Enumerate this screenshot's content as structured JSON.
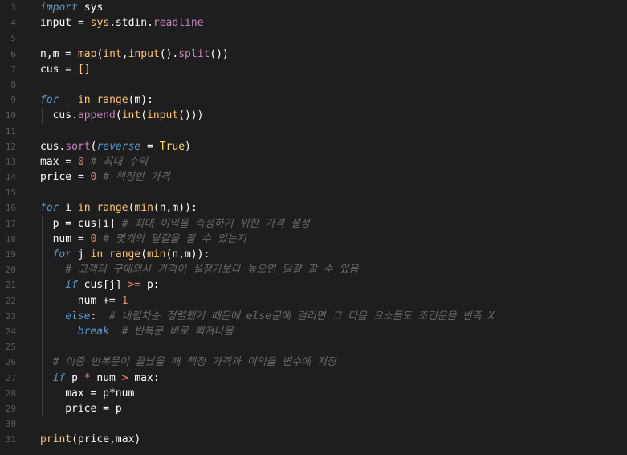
{
  "lines": [
    {
      "num": "3",
      "indent": 0,
      "tokens": [
        {
          "t": "import",
          "c": "kw"
        },
        {
          "t": " sys",
          "c": "plain"
        }
      ]
    },
    {
      "num": "4",
      "indent": 0,
      "tokens": [
        {
          "t": "input",
          "c": "plain"
        },
        {
          "t": " = ",
          "c": "plain"
        },
        {
          "t": "sys",
          "c": "fn"
        },
        {
          "t": ".stdin.",
          "c": "plain"
        },
        {
          "t": "readline",
          "c": "prop"
        }
      ]
    },
    {
      "num": "5",
      "indent": 0,
      "tokens": []
    },
    {
      "num": "6",
      "indent": 0,
      "tokens": [
        {
          "t": "n,m",
          "c": "plain"
        },
        {
          "t": " = ",
          "c": "plain"
        },
        {
          "t": "map",
          "c": "fn"
        },
        {
          "t": "(",
          "c": "plain"
        },
        {
          "t": "int",
          "c": "fn"
        },
        {
          "t": ",",
          "c": "plain"
        },
        {
          "t": "input",
          "c": "fn"
        },
        {
          "t": "().",
          "c": "plain"
        },
        {
          "t": "split",
          "c": "prop"
        },
        {
          "t": "())",
          "c": "plain"
        }
      ]
    },
    {
      "num": "7",
      "indent": 0,
      "tokens": [
        {
          "t": "cus",
          "c": "plain"
        },
        {
          "t": " = ",
          "c": "plain"
        },
        {
          "t": "[]",
          "c": "fn"
        }
      ]
    },
    {
      "num": "8",
      "indent": 0,
      "tokens": []
    },
    {
      "num": "9",
      "indent": 0,
      "tokens": [
        {
          "t": "for",
          "c": "kw"
        },
        {
          "t": " _ ",
          "c": "plain"
        },
        {
          "t": "in",
          "c": "fn"
        },
        {
          "t": " ",
          "c": "plain"
        },
        {
          "t": "range",
          "c": "fn"
        },
        {
          "t": "(m):",
          "c": "plain"
        }
      ]
    },
    {
      "num": "10",
      "indent": 1,
      "tokens": [
        {
          "t": "cus.",
          "c": "plain"
        },
        {
          "t": "append",
          "c": "prop"
        },
        {
          "t": "(",
          "c": "plain"
        },
        {
          "t": "int",
          "c": "fn"
        },
        {
          "t": "(",
          "c": "plain"
        },
        {
          "t": "input",
          "c": "fn"
        },
        {
          "t": "()))",
          "c": "plain"
        }
      ]
    },
    {
      "num": "11",
      "indent": 0,
      "tokens": []
    },
    {
      "num": "12",
      "indent": 0,
      "tokens": [
        {
          "t": "cus.",
          "c": "plain"
        },
        {
          "t": "sort",
          "c": "prop"
        },
        {
          "t": "(",
          "c": "plain"
        },
        {
          "t": "reverse",
          "c": "kw"
        },
        {
          "t": " = ",
          "c": "plain"
        },
        {
          "t": "True",
          "c": "bool"
        },
        {
          "t": ")",
          "c": "plain"
        }
      ]
    },
    {
      "num": "13",
      "indent": 0,
      "tokens": [
        {
          "t": "max",
          "c": "plain"
        },
        {
          "t": " = ",
          "c": "plain"
        },
        {
          "t": "0",
          "c": "num"
        },
        {
          "t": " # 최대 수익",
          "c": "cm"
        }
      ]
    },
    {
      "num": "14",
      "indent": 0,
      "tokens": [
        {
          "t": "price",
          "c": "plain"
        },
        {
          "t": " = ",
          "c": "plain"
        },
        {
          "t": "0",
          "c": "num"
        },
        {
          "t": " # 책정한 가격",
          "c": "cm"
        }
      ]
    },
    {
      "num": "15",
      "indent": 0,
      "tokens": []
    },
    {
      "num": "16",
      "indent": 0,
      "tokens": [
        {
          "t": "for",
          "c": "kw"
        },
        {
          "t": " i ",
          "c": "plain"
        },
        {
          "t": "in",
          "c": "fn"
        },
        {
          "t": " ",
          "c": "plain"
        },
        {
          "t": "range",
          "c": "fn"
        },
        {
          "t": "(",
          "c": "plain"
        },
        {
          "t": "min",
          "c": "fn"
        },
        {
          "t": "(n,m)):",
          "c": "plain"
        }
      ]
    },
    {
      "num": "17",
      "indent": 1,
      "tokens": [
        {
          "t": "p",
          "c": "plain"
        },
        {
          "t": " = ",
          "c": "plain"
        },
        {
          "t": "cus[i]",
          "c": "plain"
        },
        {
          "t": " # 최대 이익을 측정하기 위한 가격 설정",
          "c": "cm"
        }
      ]
    },
    {
      "num": "18",
      "indent": 1,
      "tokens": [
        {
          "t": "num",
          "c": "plain"
        },
        {
          "t": " = ",
          "c": "plain"
        },
        {
          "t": "0",
          "c": "num"
        },
        {
          "t": " # 몇개의 달걀을 팔 수 있는지",
          "c": "cm"
        }
      ]
    },
    {
      "num": "19",
      "indent": 1,
      "tokens": [
        {
          "t": "for",
          "c": "kw"
        },
        {
          "t": " j ",
          "c": "plain"
        },
        {
          "t": "in",
          "c": "fn"
        },
        {
          "t": " ",
          "c": "plain"
        },
        {
          "t": "range",
          "c": "fn"
        },
        {
          "t": "(",
          "c": "plain"
        },
        {
          "t": "min",
          "c": "fn"
        },
        {
          "t": "(n,m)):",
          "c": "plain"
        }
      ]
    },
    {
      "num": "20",
      "indent": 2,
      "tokens": [
        {
          "t": "# 고객의 구매의사 가격이 설정가보다 높으면 달걀 팔 수 있음",
          "c": "cm"
        }
      ]
    },
    {
      "num": "21",
      "indent": 2,
      "tokens": [
        {
          "t": "if",
          "c": "kw"
        },
        {
          "t": " cus[j] ",
          "c": "plain"
        },
        {
          "t": ">=",
          "c": "op"
        },
        {
          "t": " p:",
          "c": "plain"
        }
      ]
    },
    {
      "num": "22",
      "indent": 3,
      "tokens": [
        {
          "t": "num",
          "c": "plain"
        },
        {
          "t": " += ",
          "c": "plain"
        },
        {
          "t": "1",
          "c": "num"
        }
      ]
    },
    {
      "num": "23",
      "indent": 2,
      "tokens": [
        {
          "t": "else",
          "c": "kw"
        },
        {
          "t": ":  ",
          "c": "plain"
        },
        {
          "t": "# 내림차순 정렬했기 때문에 else문에 걸리면 그 다음 요소들도 조건문을 반족 X",
          "c": "cm"
        }
      ]
    },
    {
      "num": "24",
      "indent": 3,
      "tokens": [
        {
          "t": "break",
          "c": "kw"
        },
        {
          "t": "  ",
          "c": "plain"
        },
        {
          "t": "# 반복문 바로 빠져나옴",
          "c": "cm"
        }
      ]
    },
    {
      "num": "25",
      "indent": 1,
      "tokens": []
    },
    {
      "num": "26",
      "indent": 1,
      "tokens": [
        {
          "t": "# 이중 반복문이 끝났을 때 책정 가격과 이익을 변수에 저장",
          "c": "cm"
        }
      ]
    },
    {
      "num": "27",
      "indent": 1,
      "tokens": [
        {
          "t": "if",
          "c": "kw"
        },
        {
          "t": " p ",
          "c": "plain"
        },
        {
          "t": "*",
          "c": "op"
        },
        {
          "t": " num ",
          "c": "plain"
        },
        {
          "t": ">",
          "c": "op"
        },
        {
          "t": " max:",
          "c": "plain"
        }
      ]
    },
    {
      "num": "28",
      "indent": 2,
      "tokens": [
        {
          "t": "max",
          "c": "plain"
        },
        {
          "t": " = ",
          "c": "plain"
        },
        {
          "t": "p*num",
          "c": "plain"
        }
      ]
    },
    {
      "num": "29",
      "indent": 2,
      "tokens": [
        {
          "t": "price",
          "c": "plain"
        },
        {
          "t": " = ",
          "c": "plain"
        },
        {
          "t": "p",
          "c": "plain"
        }
      ]
    },
    {
      "num": "30",
      "indent": 0,
      "tokens": []
    },
    {
      "num": "31",
      "indent": 0,
      "tokens": [
        {
          "t": "print",
          "c": "fn"
        },
        {
          "t": "(price,max)",
          "c": "plain"
        }
      ]
    }
  ],
  "colors": {
    "background": "#1e1e1e",
    "line_number": "#5a5a5a",
    "keyword": "#569cd6",
    "function": "#ffc66d",
    "number": "#f48771",
    "comment": "#6a6a6a",
    "plain": "#ffffff",
    "property": "#c586c0",
    "bool": "#ffd966"
  }
}
